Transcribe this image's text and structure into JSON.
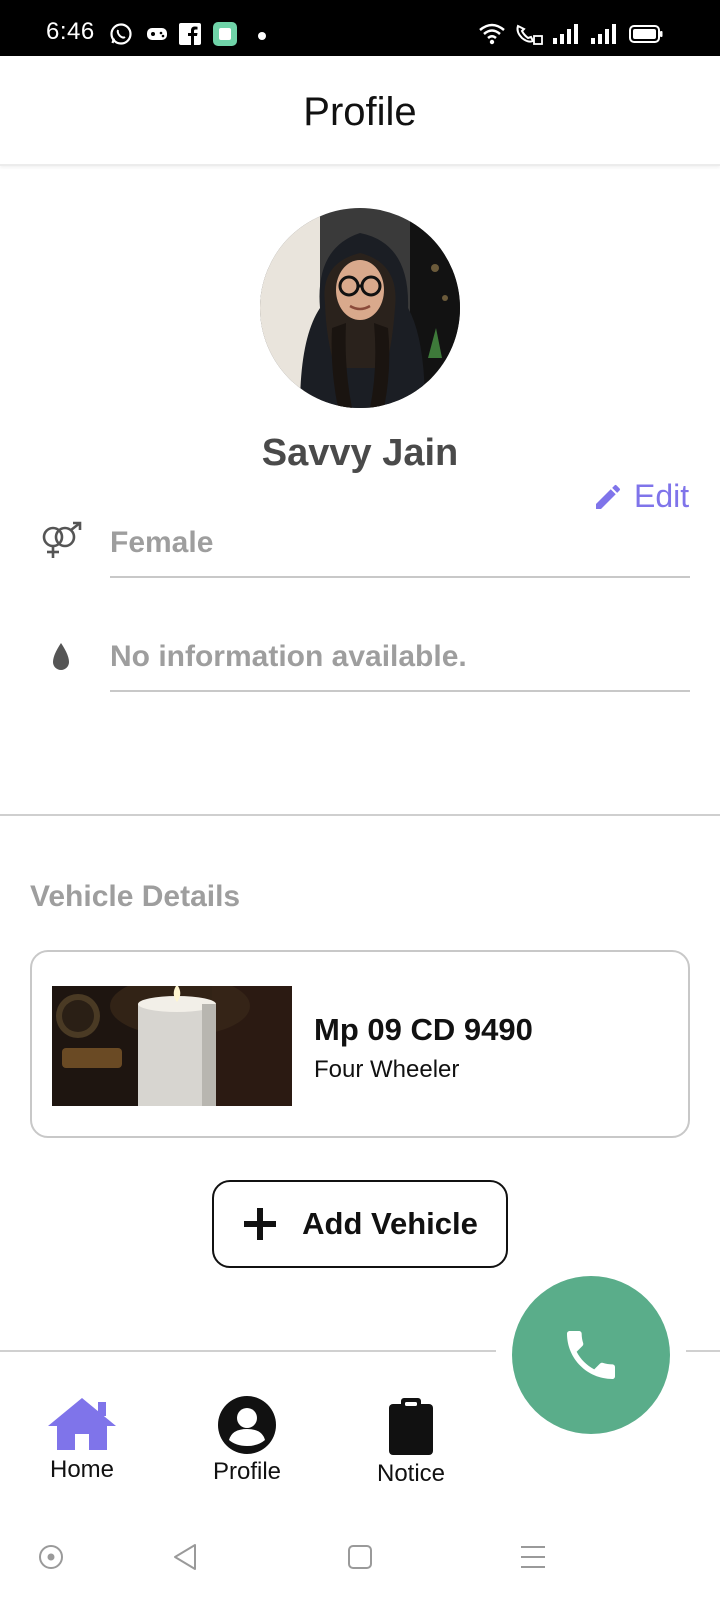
{
  "status_bar": {
    "time": "6:46",
    "left_icons": [
      "whatsapp-icon",
      "gamepad-icon",
      "facebook-icon",
      "app-icon",
      "notification-dot"
    ],
    "right_icons": [
      "wifi-icon",
      "wifi-calling-icon",
      "signal-icon",
      "signal-icon",
      "battery-icon"
    ]
  },
  "appbar": {
    "title": "Profile"
  },
  "profile": {
    "name": "Savvy Jain",
    "edit_label": "Edit",
    "gender": "Female",
    "blood_group": "No information available."
  },
  "vehicles": {
    "section_title": "Vehicle Details",
    "items": [
      {
        "plate": "Mp 09 CD 9490",
        "type": "Four Wheeler"
      }
    ],
    "add_button_label": "Add Vehicle"
  },
  "bottom_nav": {
    "items": [
      {
        "label": "Home",
        "icon": "home-icon",
        "active": true
      },
      {
        "label": "Profile",
        "icon": "account-circle-icon",
        "active": false
      },
      {
        "label": "Notice",
        "icon": "clipboard-icon",
        "active": false
      }
    ],
    "fab_icon": "phone-icon"
  },
  "system_nav": {
    "buttons": [
      "assist-icon",
      "back-icon",
      "home-square-icon",
      "menu-icon"
    ]
  },
  "colors": {
    "accent": "#7f74ea",
    "fab": "#5aad8a",
    "muted_text": "#9e9e9e",
    "name_text": "#4a4a4a"
  }
}
